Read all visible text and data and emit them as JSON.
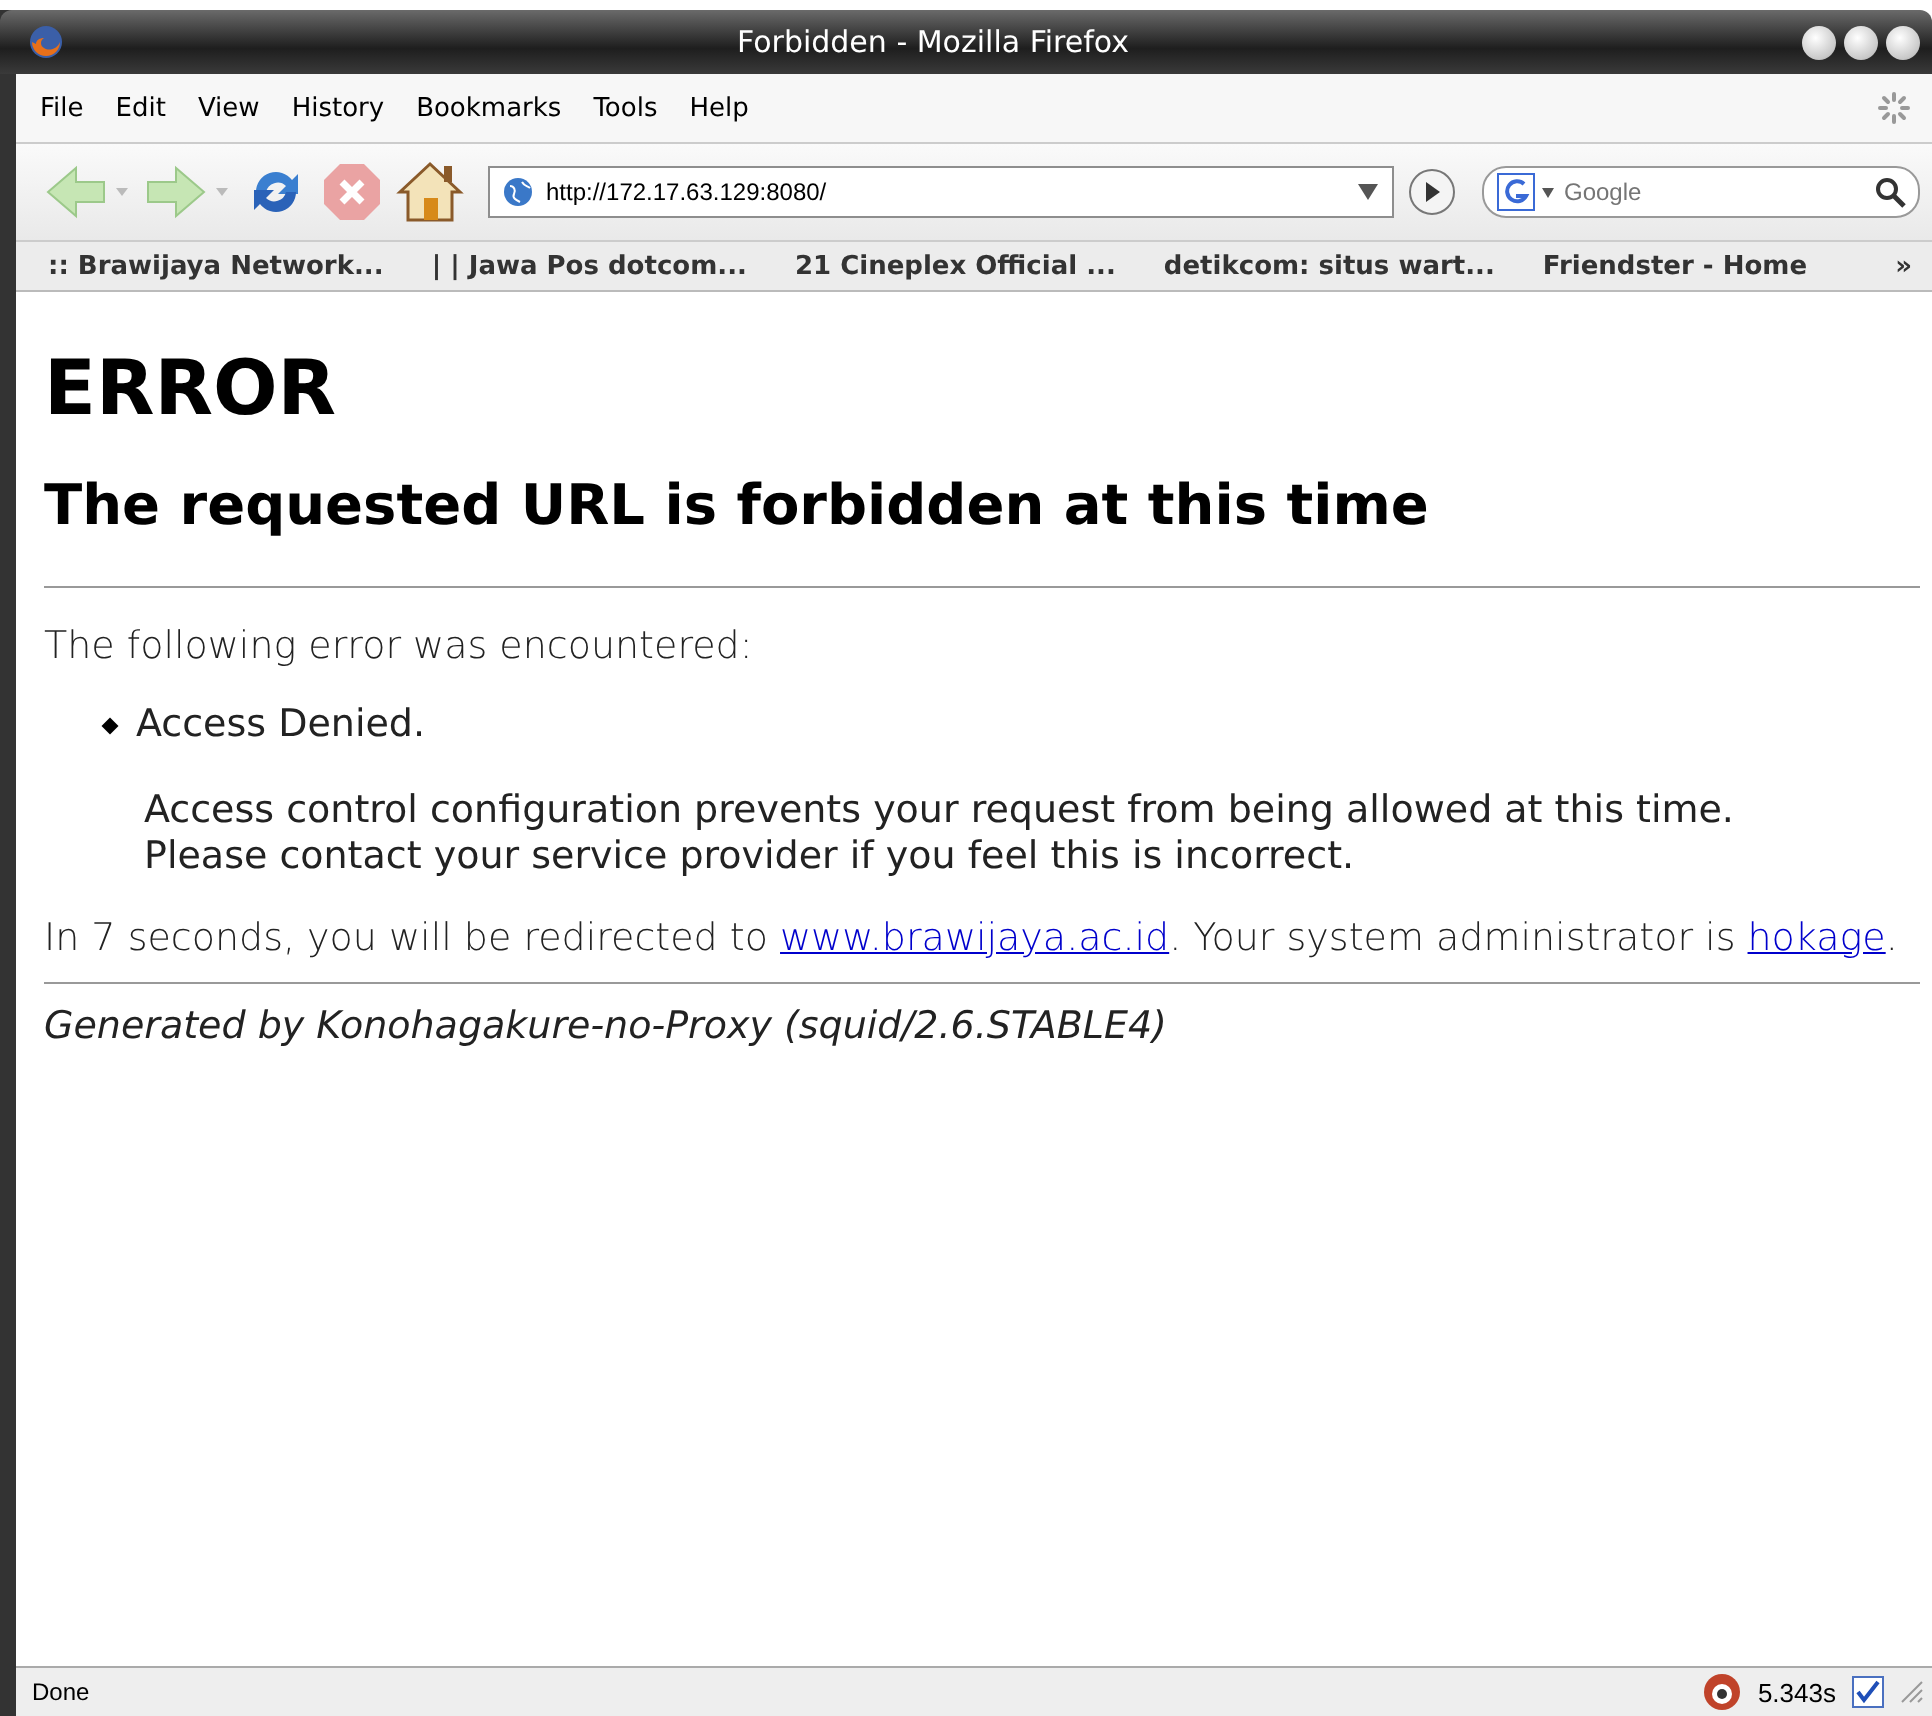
{
  "window": {
    "title": "Forbidden - Mozilla Firefox"
  },
  "menu": [
    "File",
    "Edit",
    "View",
    "History",
    "Bookmarks",
    "Tools",
    "Help"
  ],
  "toolbar": {
    "url": "http://172.17.63.129:8080/",
    "search_placeholder": "Google"
  },
  "bookmarks": [
    ":: Brawijaya Network...",
    "| | Jawa Pos dotcom...",
    "21 Cineplex Official ...",
    "detikcom: situs wart...",
    "Friendster - Home"
  ],
  "bookmarks_overflow": "»",
  "page": {
    "heading": "ERROR",
    "subheading": "The requested URL is forbidden at this time",
    "intro": "The following error was encountered:",
    "errors": [
      {
        "title": "Access Denied.",
        "lines": [
          "Access control configuration prevents your request from being allowed at this time.",
          "Please contact your service provider if you feel this is incorrect."
        ]
      }
    ],
    "redirect": [
      {
        "kind": "text",
        "text": "In 7 seconds, you will be redirected to "
      },
      {
        "kind": "link",
        "text": "www.brawijaya.ac.id"
      },
      {
        "kind": "text",
        "text": ". Your system administrator is "
      },
      {
        "kind": "link",
        "text": "hokage"
      },
      {
        "kind": "text",
        "text": "."
      }
    ],
    "footer": "Generated by Konohagakure-no-Proxy (squid/2.6.STABLE4)"
  },
  "status_bar": {
    "text": "Done",
    "time": "5.343s"
  }
}
